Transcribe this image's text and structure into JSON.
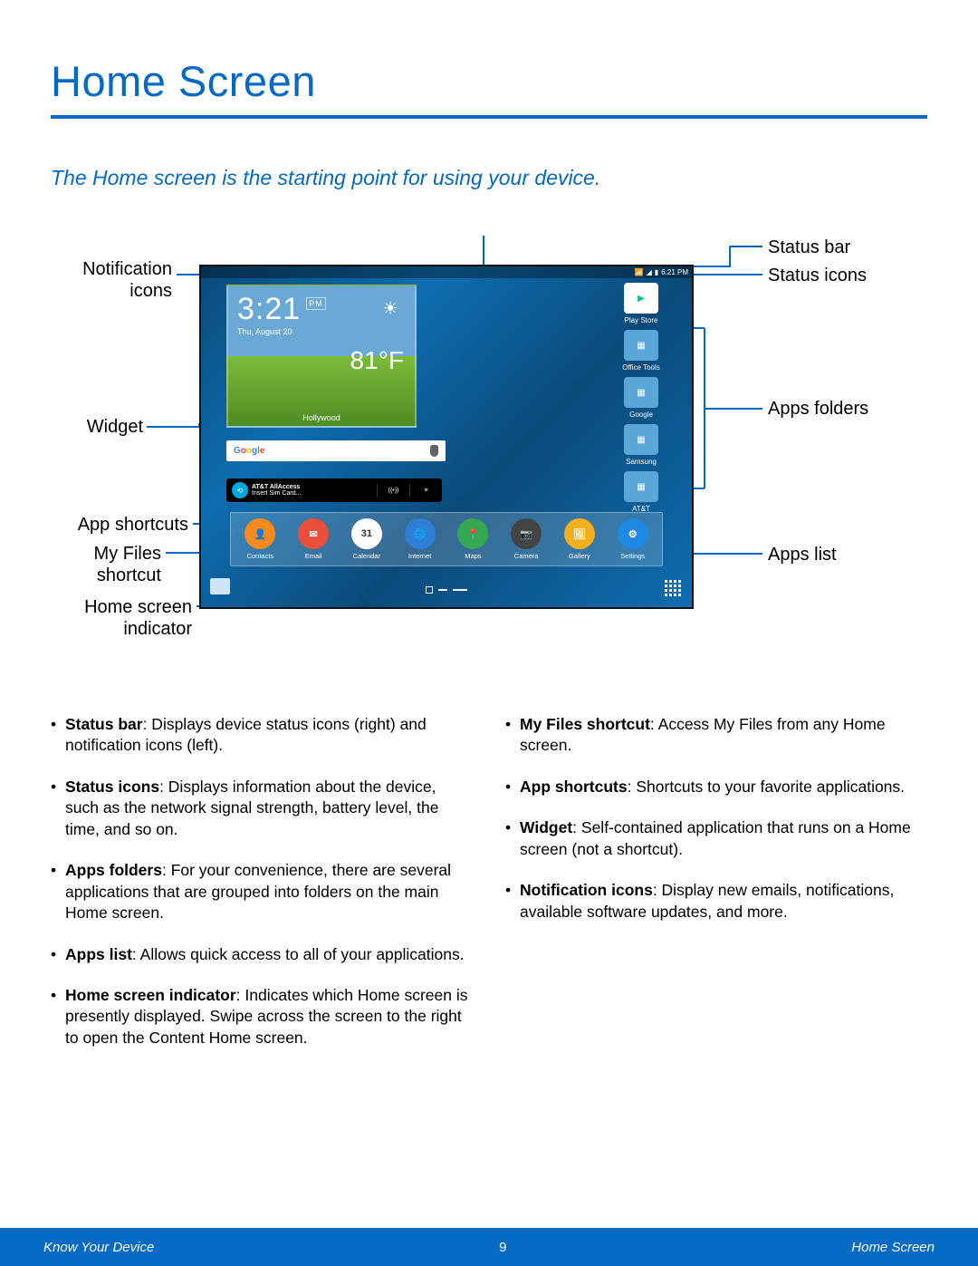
{
  "page": {
    "title": "Home Screen",
    "intro": "The Home screen is the starting point for using your device."
  },
  "labels": {
    "notification_icons": "Notification\nicons",
    "widget": "Widget",
    "app_shortcuts": "App shortcuts",
    "my_files": "My Files\nshortcut",
    "home_indicator": "Home screen\nindicator",
    "status_bar": "Status bar",
    "status_icons": "Status icons",
    "apps_folders": "Apps folders",
    "apps_list": "Apps list"
  },
  "tablet": {
    "status_time": "6:21 PM",
    "clock_time": "3:21",
    "clock_ampm": "PM",
    "clock_date": "Thu, August 20",
    "weather_temp": "81°F",
    "weather_loc": "Hollywood",
    "google_label": "Google",
    "att_main": "AT&T AllAccess",
    "att_sub": "Insert Sim Card...",
    "folders": [
      {
        "label": "Play Store",
        "color": "#fff",
        "tile": false
      },
      {
        "label": "Office Tools",
        "color": "#5aa6d8",
        "tile": true
      },
      {
        "label": "Google",
        "color": "#5aa6d8",
        "tile": true
      },
      {
        "label": "Samsung",
        "color": "#5aa6d8",
        "tile": true
      },
      {
        "label": "AT&T",
        "color": "#5aa6d8",
        "tile": true
      }
    ],
    "dock": [
      {
        "label": "Contacts",
        "color": "#f58b1f",
        "glyph": "👤"
      },
      {
        "label": "Email",
        "color": "#e94f3b",
        "glyph": "✉"
      },
      {
        "label": "Calendar",
        "color": "#ffffff",
        "glyph": "31",
        "text": "#333"
      },
      {
        "label": "Internet",
        "color": "#2f7ed8",
        "glyph": "🌐"
      },
      {
        "label": "Maps",
        "color": "#34a853",
        "glyph": "📍"
      },
      {
        "label": "Camera",
        "color": "#444",
        "glyph": "📷"
      },
      {
        "label": "Gallery",
        "color": "#f2b01e",
        "glyph": "🖼"
      },
      {
        "label": "Settings",
        "color": "#1e88e5",
        "glyph": "⚙"
      }
    ]
  },
  "bullets_left": [
    {
      "term": "Status bar",
      "desc": ": Displays device status icons (right) and notification icons (left)."
    },
    {
      "term": "Status icons",
      "desc": ": Displays information about the device, such as the network signal strength, battery level, the time, and so on."
    },
    {
      "term": "Apps folders",
      "desc": ": For your convenience, there are several applications that are grouped into folders on the main Home screen."
    },
    {
      "term": "Apps list",
      "desc": ": Allows quick access to all of your applications."
    },
    {
      "term": "Home screen indicator",
      "desc": ": Indicates which Home screen is presently displayed. Swipe across the screen to the right to open the Content Home screen."
    }
  ],
  "bullets_right": [
    {
      "term": "My Files shortcut",
      "desc": ": Access My Files from any Home screen."
    },
    {
      "term": "App shortcuts",
      "desc": ": Shortcuts to your favorite applications."
    },
    {
      "term": "Widget",
      "desc": ": Self-contained application that runs on a Home screen (not a shortcut)."
    },
    {
      "term": "Notification icons",
      "desc": ": Display new emails, notifications, available software updates, and more."
    }
  ],
  "footer": {
    "left": "Know Your Device",
    "page": "9",
    "right": "Home Screen"
  }
}
